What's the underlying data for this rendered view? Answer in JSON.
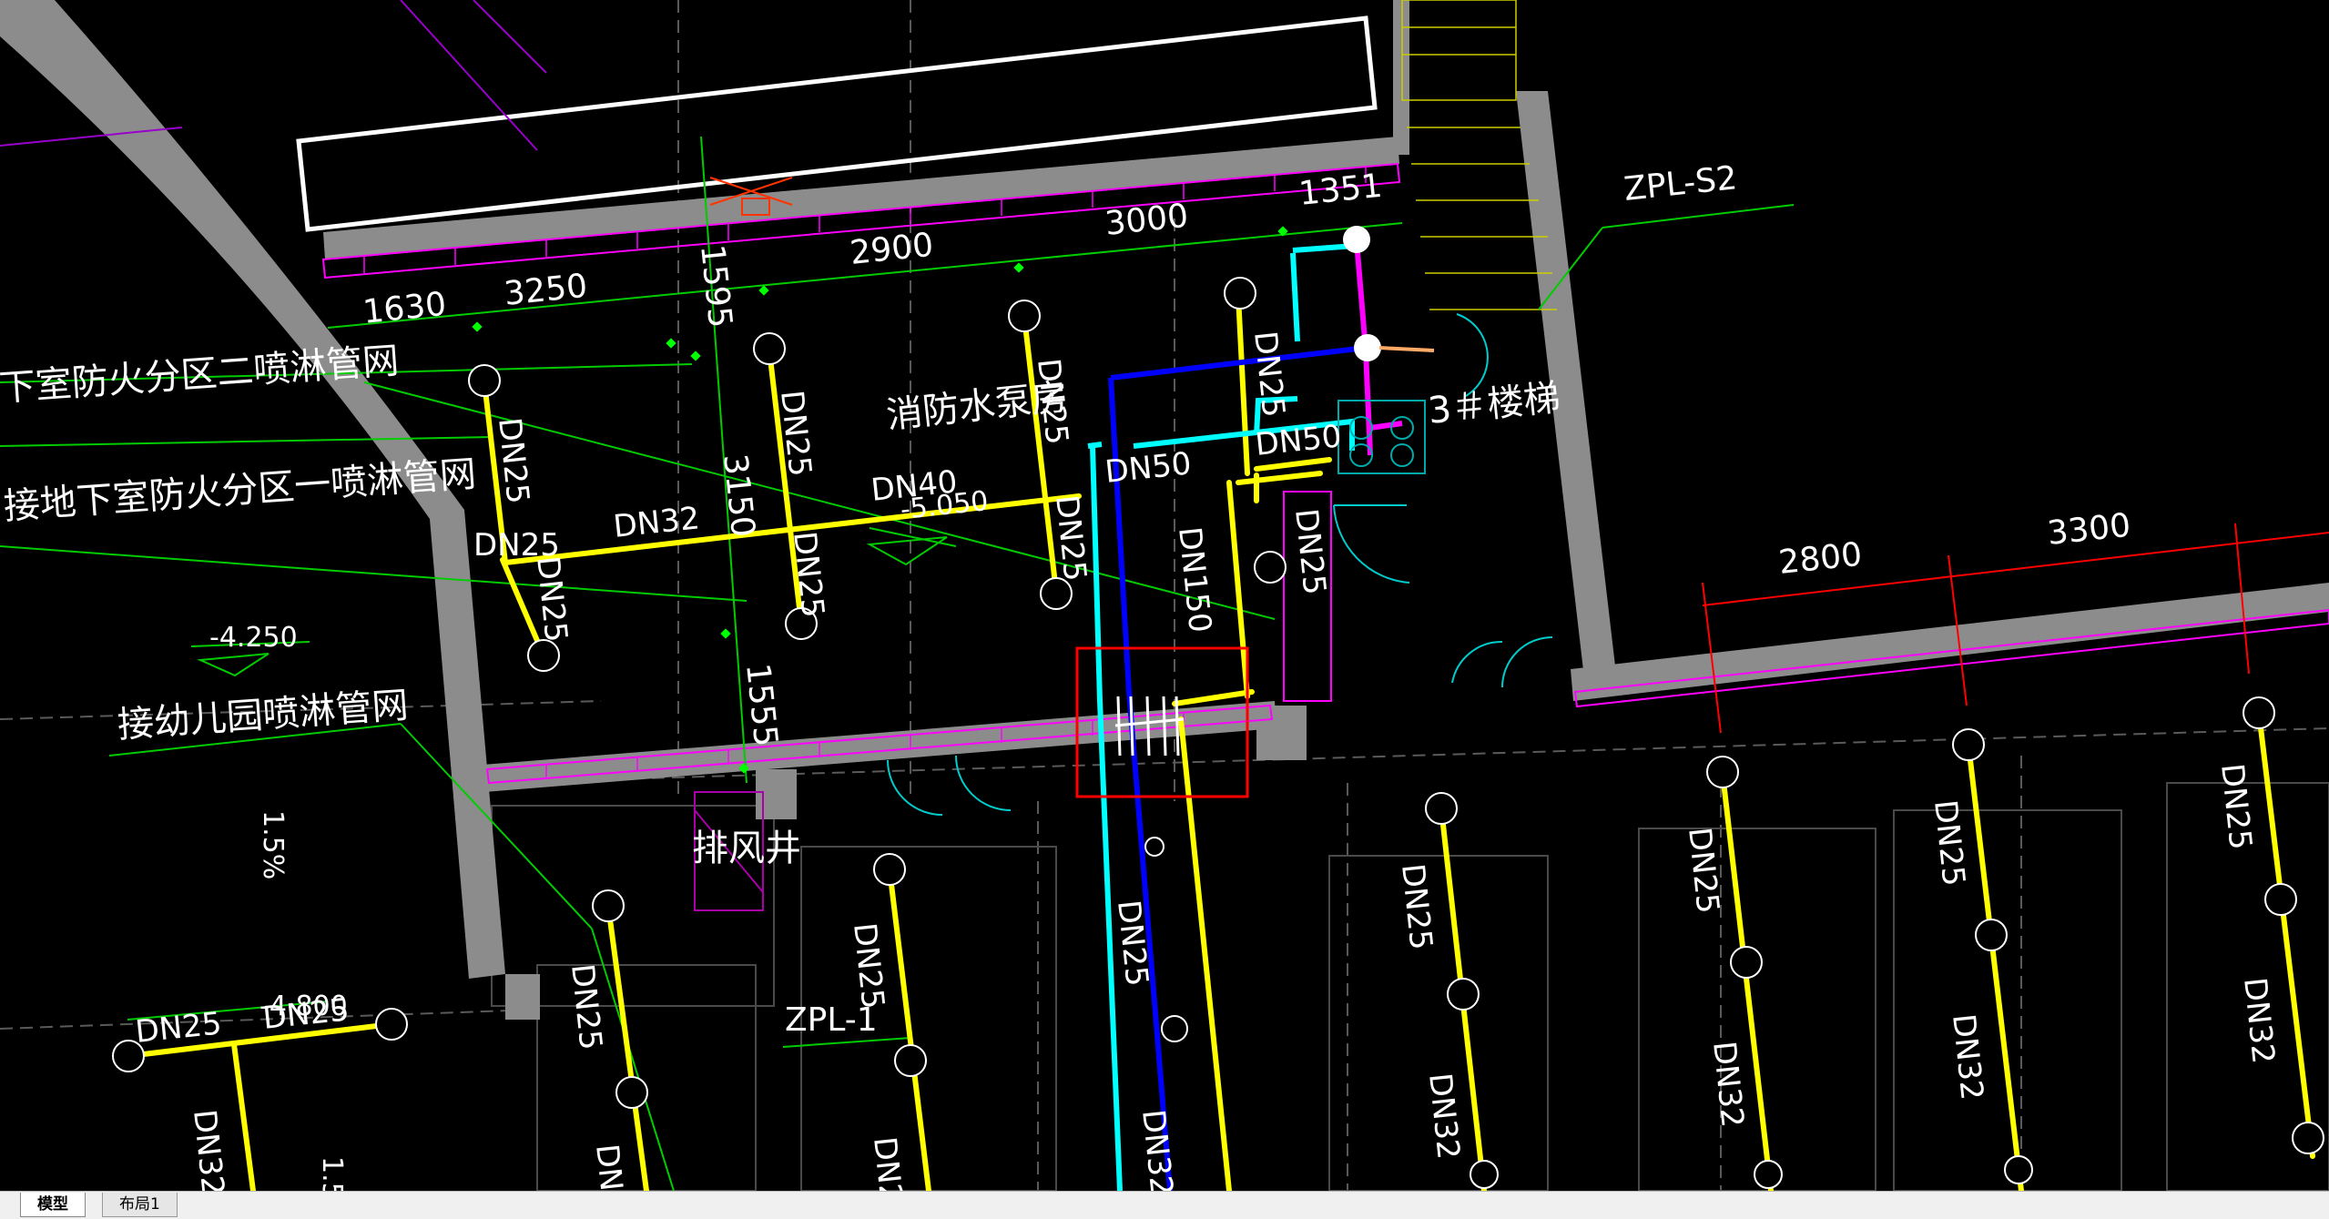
{
  "layout_tabs": [
    {
      "label": "模型",
      "active": true
    },
    {
      "label": "布局1",
      "active": false
    }
  ],
  "drawing": {
    "room_labels": {
      "pump_room": "消防水泵房",
      "stair": "3＃楼梯",
      "exhaust_shaft": "排风井"
    },
    "notes": {
      "zone2": "下室防火分区二喷淋管网",
      "zone1": "接地下室防火分区一喷淋管网",
      "kindergarten": "接幼儿园喷淋管网"
    },
    "riser_labels": {
      "zpl_s2": "ZPL-S2",
      "zpl_1": "ZPL-1"
    },
    "dimensions": [
      "1630",
      "3250",
      "2900",
      "3000",
      "1351",
      "1595",
      "3150",
      "1555",
      "2800",
      "3300"
    ],
    "elevations": {
      "pump_room": "-5.050",
      "kindergarten": "-4.250",
      "lower": "-4.800"
    },
    "slope_labels": [
      "1.5%",
      "1.5%"
    ],
    "pipe_sizes": {
      "dn25": "DN25",
      "dn32": "DN32",
      "dn40": "DN40",
      "dn50": "DN50",
      "dn150": "DN150"
    },
    "colors": {
      "background": "#000000",
      "yellow_pipe": "#ffff00",
      "blue_pipe": "#0000ff",
      "cyan_pipe": "#00ffff",
      "magenta": "#ff00ff",
      "wall": "#808080",
      "dimension": "#00ff00",
      "red_dimension": "#ff0000",
      "white": "#ffffff",
      "selection_box": "#ff0000"
    }
  }
}
